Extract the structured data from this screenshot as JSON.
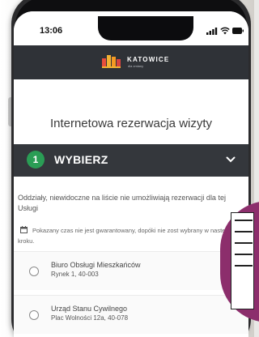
{
  "status_bar": {
    "time": "13:06"
  },
  "header": {
    "logo_text": "KATOWICE",
    "logo_subtext": "dla zmiany",
    "background": "#2f3237"
  },
  "page": {
    "title": "Internetowa rezerwacja wizyty"
  },
  "step": {
    "number": "1",
    "label": "WYBIERZ",
    "badge_color": "#2a9d55"
  },
  "info": {
    "text": "Oddziały, niewidoczne na liście nie umożliwiają rezerwacji dla tej Usługi",
    "note": "Pokazany czas nie jest gwarantowany, dopóki nie zost wybrany w następnym kroku."
  },
  "options": [
    {
      "name": "Biuro Obsługi Mieszkańców",
      "address": "Rynek 1, 40-003",
      "selected": false
    },
    {
      "name": "Urząd Stanu Cywilnego",
      "address": "Plac Wolności 12a, 40-078",
      "selected": false
    }
  ],
  "icons": {
    "signal": "signal-icon",
    "wifi": "wifi-icon",
    "battery": "battery-icon",
    "logo": "katowice-logo-icon",
    "chevron": "chevron-down-icon",
    "calendar": "calendar-icon",
    "radio": "radio-icon"
  },
  "accent_color": "#8c2e6c"
}
